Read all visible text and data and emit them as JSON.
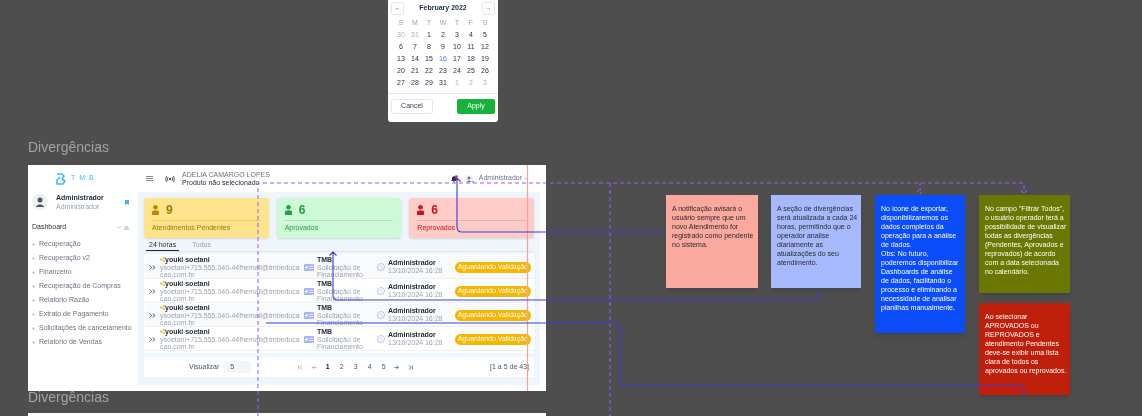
{
  "calendar": {
    "prev": "←",
    "month": "February 2022",
    "next": "→",
    "weekdays": [
      "S",
      "M",
      "T",
      "W",
      "T",
      "F",
      "S"
    ],
    "weeks": [
      [
        {
          "day": "30",
          "muted": true,
          "today": false
        },
        {
          "day": "31",
          "muted": true,
          "today": false
        },
        {
          "day": "1",
          "muted": false,
          "today": false
        },
        {
          "day": "2",
          "muted": false,
          "today": false
        },
        {
          "day": "3",
          "muted": false,
          "today": false
        },
        {
          "day": "4",
          "muted": false,
          "today": false
        },
        {
          "day": "5",
          "muted": false,
          "today": false
        }
      ],
      [
        {
          "day": "6",
          "muted": false,
          "today": false
        },
        {
          "day": "7",
          "muted": false,
          "today": false
        },
        {
          "day": "8",
          "muted": false,
          "today": false
        },
        {
          "day": "9",
          "muted": false,
          "today": false
        },
        {
          "day": "10",
          "muted": false,
          "today": false
        },
        {
          "day": "11",
          "muted": false,
          "today": false
        },
        {
          "day": "12",
          "muted": false,
          "today": false
        }
      ],
      [
        {
          "day": "13",
          "muted": false,
          "today": false
        },
        {
          "day": "14",
          "muted": false,
          "today": false
        },
        {
          "day": "15",
          "muted": false,
          "today": false
        },
        {
          "day": "16",
          "muted": false,
          "today": true
        },
        {
          "day": "17",
          "muted": false,
          "today": false
        },
        {
          "day": "18",
          "muted": false,
          "today": false
        },
        {
          "day": "19",
          "muted": false,
          "today": false
        }
      ],
      [
        {
          "day": "20",
          "muted": false,
          "today": false
        },
        {
          "day": "21",
          "muted": false,
          "today": false
        },
        {
          "day": "22",
          "muted": false,
          "today": false
        },
        {
          "day": "23",
          "muted": false,
          "today": false
        },
        {
          "day": "24",
          "muted": false,
          "today": false
        },
        {
          "day": "25",
          "muted": false,
          "today": false
        },
        {
          "day": "26",
          "muted": false,
          "today": false
        }
      ],
      [
        {
          "day": "27",
          "muted": false,
          "today": false
        },
        {
          "day": "28",
          "muted": false,
          "today": false
        },
        {
          "day": "29",
          "muted": false,
          "today": false
        },
        {
          "day": "31",
          "muted": false,
          "today": false
        },
        {
          "day": "1",
          "muted": true,
          "today": false
        },
        {
          "day": "2",
          "muted": true,
          "today": false
        },
        {
          "day": "3",
          "muted": true,
          "today": false
        }
      ]
    ],
    "cancel": "Cancel",
    "apply": "Apply"
  },
  "frame_titles": [
    "Divergências",
    "Divergências"
  ],
  "dashboard": {
    "header": {
      "logo": "TMB",
      "company": "ADELIA CAMARGO LOPES",
      "product": "Produto não selecionado",
      "user": "Administrador",
      "unread": true
    },
    "sidebar": {
      "user_name": "Administrador",
      "user_role": "Administrador",
      "section": "Dashboard",
      "items": [
        "Recuperação",
        "Recuperação v2",
        "Financeiro",
        "Recuperação de Compras",
        "Relatório Razão",
        "Extrato de Pagamento",
        "Solicitações de cancelamento",
        "Relatório de Vendas"
      ]
    },
    "cards": [
      {
        "kind": "pending",
        "count": "9",
        "label": "Atendimentos Pendentes"
      },
      {
        "kind": "approved",
        "count": "6",
        "label": "Aprovados"
      },
      {
        "kind": "rejected",
        "count": "6",
        "label": "Reprovados"
      }
    ],
    "tabs": [
      {
        "label": "24 horas",
        "selected": true
      },
      {
        "label": "Todos",
        "selected": false
      }
    ],
    "rows": [
      {
        "name": "youki soetani",
        "email": "ysoetani+715.555.040-44fhemail@tmbeducacao.com.br",
        "company": "TMB",
        "request": "Solicitação de Financiamento",
        "agent": "Administrador",
        "date": "13/10/2024 16:28",
        "status": "Aguardando Validação"
      },
      {
        "name": "youki soetani",
        "email": "ysoetani+715.555.040-44fhemail@tmbeducacao.com.br",
        "company": "TMB",
        "request": "Solicitação de Financiamento",
        "agent": "Administrador",
        "date": "13/10/2024 16:28",
        "status": "Aguardando Validação"
      },
      {
        "name": "youki soetani",
        "email": "ysoetani+715.555.040-44fhemail@tmbeducacao.com.br",
        "company": "TMB",
        "request": "Solicitação de Financiamento",
        "agent": "Administrador",
        "date": "13/10/2024 16:28",
        "status": "Aguardando Validação"
      },
      {
        "name": "youki soetani",
        "email": "ysoetani+715.555.040-44fhemail@tmbeducacao.com.br",
        "company": "TMB",
        "request": "Solicitação de Financiamento",
        "agent": "Administrador",
        "date": "13/10/2024 16:28",
        "status": "Aguardando Validação"
      }
    ],
    "pagination": {
      "label": "Visualizar",
      "page_size": "5",
      "pages": [
        {
          "label": "1",
          "selected": true
        },
        {
          "label": "2",
          "selected": false
        },
        {
          "label": "3",
          "selected": false
        },
        {
          "label": "4",
          "selected": false
        },
        {
          "label": "5",
          "selected": false
        }
      ],
      "summary": "[1 a 5 de 43]"
    }
  },
  "notes": [
    {
      "color": "#fba99f",
      "text": "A notificação avisará o usuário sempre que um novo Atendimento for registrado como pendente no sistema."
    },
    {
      "color": "#a6b9fd",
      "text": "A seção de divergências será atualizada a cada 24 horas, permitindo que o operador analise diariamente as atualizações do seu atendimento."
    },
    {
      "color": "#0b4dfb",
      "text": "No ícone de exportar, disponibilizaremos os dados completos da operação para a análise de dados.\nObs: No futuro, poderemos disponibilizar Dashboards de análise de dados, facilitando o processo e eliminando a necessidade de analisar planilhas manualmente."
    },
    {
      "color": "#6a7700",
      "text": "No campo \"Filtrar Todos\", o usuário operador terá a possibilidade de visualizar todas as divergências (Pendentes, Aprovados e reprovados) de acordo com a data selecionada no calendário."
    },
    {
      "color": "#bf200b",
      "text": "Ao selecionar APROVADOS ou REPROVADOS e atendimento Pendentes deve-se exibir uma lista clara de todos os aprovados ou reprovados."
    }
  ]
}
